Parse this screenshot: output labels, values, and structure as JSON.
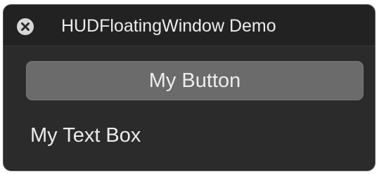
{
  "window": {
    "title": "HUDFloatingWindow Demo",
    "close_icon": "close-x-circle-icon",
    "background_color": "#2b2b2b",
    "titlebar_color": "#222222"
  },
  "content": {
    "button_label": "My Button",
    "button_color": "#6b6b6b",
    "text_box_value": "My Text Box"
  }
}
